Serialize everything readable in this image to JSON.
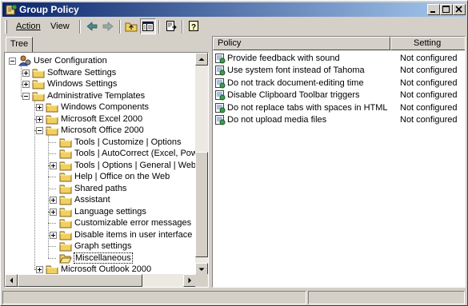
{
  "window": {
    "title": "Group Policy"
  },
  "menu": {
    "action": "Action",
    "view": "View"
  },
  "toolbar": {
    "icons": [
      "back-arrow-icon",
      "forward-arrow-icon",
      "up-folder-icon",
      "show-hide-tree-icon",
      "export-list-icon",
      "help-icon"
    ]
  },
  "left_tab": {
    "label": "Tree"
  },
  "tree": {
    "items": [
      {
        "label": "User Configuration",
        "toggle": "minus",
        "icon": "user-config-icon"
      },
      {
        "label": "Software Settings",
        "toggle": "plus",
        "icon": "folder-icon"
      },
      {
        "label": "Windows Settings",
        "toggle": "plus",
        "icon": "folder-icon"
      },
      {
        "label": "Administrative Templates",
        "toggle": "minus",
        "icon": "folder-icon"
      },
      {
        "label": "Windows Components",
        "toggle": "plus",
        "icon": "folder-icon"
      },
      {
        "label": "Microsoft Excel 2000",
        "toggle": "plus",
        "icon": "folder-icon"
      },
      {
        "label": "Microsoft Office 2000",
        "toggle": "minus",
        "icon": "folder-icon"
      },
      {
        "label": "Tools | Customize | Options",
        "toggle": "",
        "icon": "folder-icon"
      },
      {
        "label": "Tools | AutoCorrect (Excel, PowerP",
        "toggle": "",
        "icon": "folder-icon"
      },
      {
        "label": "Tools | Options | General | Web Op",
        "toggle": "plus",
        "icon": "folder-icon"
      },
      {
        "label": "Help | Office on the Web",
        "toggle": "",
        "icon": "folder-icon"
      },
      {
        "label": "Shared paths",
        "toggle": "",
        "icon": "folder-icon"
      },
      {
        "label": "Assistant",
        "toggle": "plus",
        "icon": "folder-icon"
      },
      {
        "label": "Language settings",
        "toggle": "plus",
        "icon": "folder-icon"
      },
      {
        "label": "Customizable error messages",
        "toggle": "",
        "icon": "folder-icon"
      },
      {
        "label": "Disable items in user interface",
        "toggle": "plus",
        "icon": "folder-icon"
      },
      {
        "label": "Graph settings",
        "toggle": "",
        "icon": "folder-icon"
      },
      {
        "label": "Miscellaneous",
        "toggle": "",
        "icon": "folder-open-icon",
        "selected": true
      },
      {
        "label": "Microsoft Outlook 2000",
        "toggle": "plus",
        "icon": "folder-icon"
      }
    ]
  },
  "policy_list": {
    "columns": {
      "policy": "Policy",
      "setting": "Setting"
    },
    "rows": [
      {
        "policy": "Provide feedback with sound",
        "setting": "Not configured"
      },
      {
        "policy": "Use system font instead of Tahoma",
        "setting": "Not configured"
      },
      {
        "policy": "Do not track document-editing time",
        "setting": "Not configured"
      },
      {
        "policy": "Disable Clipboard Toolbar triggers",
        "setting": "Not configured"
      },
      {
        "policy": "Do not replace tabs with spaces in HTML",
        "setting": "Not configured"
      },
      {
        "policy": "Do not upload media files",
        "setting": "Not configured"
      }
    ]
  }
}
